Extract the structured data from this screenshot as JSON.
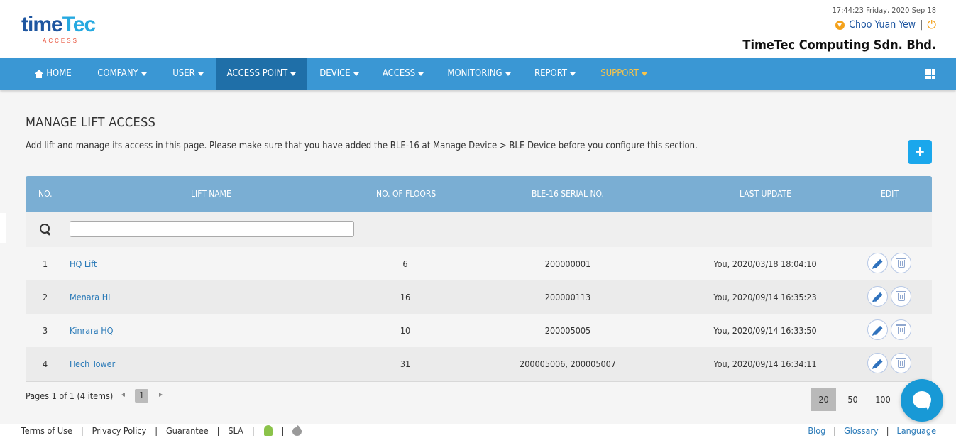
{
  "header": {
    "logo_text_a": "time",
    "logo_text_b": "Tec",
    "logo_sub": "ACCESS",
    "datetime": "17:44:23 Friday, 2020 Sep 18",
    "user_name": "Choo Yuan Yew",
    "separator": "|",
    "company": "TimeTec Computing Sdn. Bhd."
  },
  "nav": {
    "items": [
      {
        "label": "HOME"
      },
      {
        "label": "COMPANY"
      },
      {
        "label": "USER"
      },
      {
        "label": "ACCESS POINT"
      },
      {
        "label": "DEVICE"
      },
      {
        "label": "ACCESS"
      },
      {
        "label": "MONITORING"
      },
      {
        "label": "REPORT"
      },
      {
        "label": "SUPPORT"
      }
    ],
    "active": "ACCESS POINT"
  },
  "page": {
    "title": "MANAGE LIFT ACCESS",
    "description": "Add lift and manage its access in this page. Please make sure that you have added the BLE-16 at Manage Device > BLE Device before you configure this section.",
    "add_label": "+"
  },
  "table": {
    "headers": [
      "NO.",
      "LIFT NAME",
      "NO. OF FLOORS",
      "BLE-16 SERIAL NO.",
      "LAST UPDATE",
      "EDIT"
    ],
    "search_value": "",
    "rows": [
      {
        "no": "1",
        "name": "HQ Lift",
        "floors": "6",
        "serial": "200000001",
        "updated": "You, 2020/03/18 18:04:10"
      },
      {
        "no": "2",
        "name": "Menara HL",
        "floors": "16",
        "serial": "200000113",
        "updated": "You, 2020/09/14 16:35:23"
      },
      {
        "no": "3",
        "name": "Kinrara HQ",
        "floors": "10",
        "serial": "200005005",
        "updated": "You, 2020/09/14 16:33:50"
      },
      {
        "no": "4",
        "name": "ITech Tower",
        "floors": "31",
        "serial": "200005006, 200005007",
        "updated": "You, 2020/09/14 16:34:11"
      }
    ]
  },
  "pager": {
    "info": "Pages 1 of 1 (4 items)",
    "current_page": "1",
    "page_sizes": [
      "20",
      "50",
      "100"
    ],
    "selected_size": "20"
  },
  "footer": {
    "left_links": [
      "Terms of Use",
      "Privacy Policy",
      "Guarantee",
      "SLA"
    ],
    "right_links": [
      "Blog",
      "Glossary",
      "Language"
    ],
    "separator": "|"
  },
  "colors": {
    "nav_bg": "#3a97d4",
    "nav_active": "#1f6fa8",
    "support": "#f8c44a",
    "table_header": "#7aaed3",
    "link": "#2a7ab8",
    "add_button": "#1aa7ec",
    "chat": "#1899d6"
  },
  "icons": [
    "home-icon",
    "caret-down-icon",
    "grid-icon",
    "user-icon",
    "power-icon",
    "search-icon",
    "plus-icon",
    "pencil-icon",
    "trash-icon",
    "chat-icon",
    "android-icon",
    "apple-icon"
  ]
}
